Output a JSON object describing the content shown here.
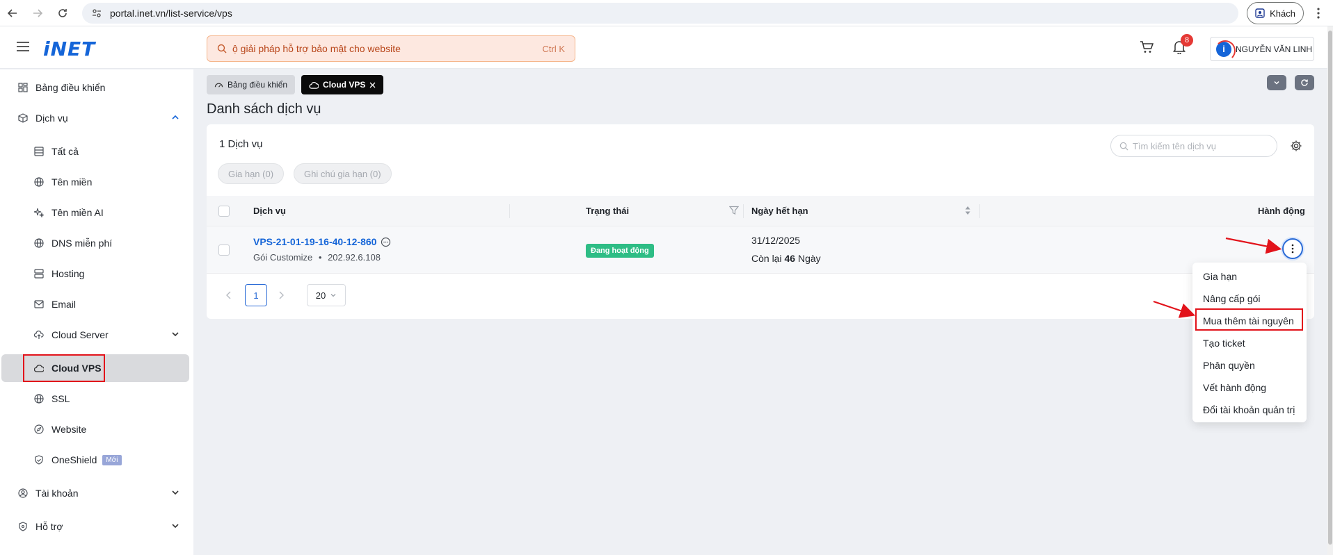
{
  "browser": {
    "url": "portal.inet.vn/list-service/vps",
    "guest_label": "Khách"
  },
  "header": {
    "logo_text": "iNET",
    "search_text": "ộ giải pháp hỗ trợ bảo mật cho website",
    "search_shortcut": "Ctrl K",
    "notification_count": "8",
    "user_name": "NGUYỄN VĂN LINH"
  },
  "sidebar": {
    "items": [
      {
        "label": "Bảng điều khiển",
        "icon": "dashboard-icon"
      },
      {
        "label": "Dịch vụ",
        "icon": "box-icon"
      },
      {
        "label": "Tất cả",
        "icon": "list-icon"
      },
      {
        "label": "Tên miền",
        "icon": "globe-icon"
      },
      {
        "label": "Tên miền AI",
        "icon": "sparkle-icon"
      },
      {
        "label": "DNS miễn phí",
        "icon": "globe-icon"
      },
      {
        "label": "Hosting",
        "icon": "server-icon"
      },
      {
        "label": "Email",
        "icon": "mail-icon"
      },
      {
        "label": "Cloud Server",
        "icon": "cloud-upload-icon"
      },
      {
        "label": "Cloud VPS",
        "icon": "cloud-icon"
      },
      {
        "label": "SSL",
        "icon": "globe-lock-icon"
      },
      {
        "label": "Website",
        "icon": "compass-icon"
      },
      {
        "label": "OneShield",
        "icon": "shield-icon"
      },
      {
        "label": "Tài khoản",
        "icon": "user-icon"
      },
      {
        "label": "Hỗ trợ",
        "icon": "help-icon"
      }
    ],
    "new_badge": "Mới"
  },
  "breadcrumbs": {
    "home": "Bảng điều khiển",
    "current": "Cloud VPS"
  },
  "page": {
    "title": "Danh sách dịch vụ",
    "service_count": "1 Dịch vụ",
    "pill_renew": "Gia hạn (0)",
    "pill_note": "Ghi chú gia hạn (0)",
    "search_placeholder": "Tìm kiếm tên dịch vụ"
  },
  "table": {
    "headers": {
      "service": "Dịch vụ",
      "status": "Trạng thái",
      "expiry": "Ngày hết hạn",
      "action": "Hành động"
    },
    "rows": [
      {
        "name": "VPS-21-01-19-16-40-12-860",
        "package": "Gói Customize",
        "separator": "•",
        "ip": "202.92.6.108",
        "status": "Đang hoạt động",
        "expiry_date": "31/12/2025",
        "remaining_prefix": "Còn lại",
        "remaining_days": "46",
        "remaining_suffix": "Ngày"
      }
    ]
  },
  "pagination": {
    "current_page": "1",
    "page_size": "20"
  },
  "action_menu": {
    "items": [
      "Gia hạn",
      "Nâng cấp gói",
      "Mua thêm tài nguyên",
      "Tạo ticket",
      "Phân quyền",
      "Vết hành động",
      "Đổi tài khoản quản trị"
    ]
  },
  "colors": {
    "brand": "#1565d8",
    "status_active": "#2ebd85",
    "annotation_red": "#e2131b"
  }
}
